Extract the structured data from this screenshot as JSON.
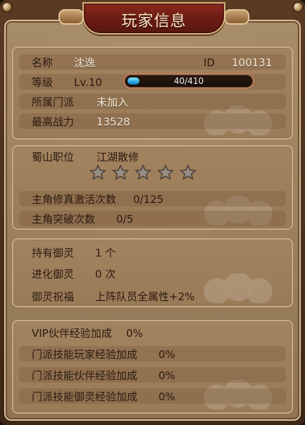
{
  "title": "玩家信息",
  "basic": {
    "name_label": "名称",
    "name_value": "沈逸",
    "id_label": "ID",
    "id_value": "100131",
    "level_label": "等级",
    "level_value": "Lv.10",
    "xp_current": 40,
    "xp_max": 410,
    "xp_text": "40/410",
    "sect_label": "所属门派",
    "sect_value": "未加入",
    "power_label": "最高战力",
    "power_value": "13528"
  },
  "shu": {
    "position_label": "蜀山职位",
    "position_value": "江湖散修",
    "stars_total": 5,
    "stars_filled": 0,
    "cultivate_label": "主角修真激活次数",
    "cultivate_value": "0/125",
    "breakthrough_label": "主角突破次数",
    "breakthrough_value": "0/5"
  },
  "yuling": {
    "own_label": "持有御灵",
    "own_value": "1 个",
    "evolve_label": "进化御灵",
    "evolve_value": "0 次",
    "bless_label": "御灵祝福",
    "bless_value": "上阵队员全属性+2%"
  },
  "bonuses": {
    "vip_label": "VIP伙伴经验加成",
    "vip_value": "0%",
    "player_label": "门派技能玩家经验加成",
    "player_value": "0%",
    "partner_label": "门派技能伙伴经验加成",
    "partner_value": "0%",
    "yuling_label": "门派技能御灵经验加成",
    "yuling_value": "0%"
  },
  "colors": {
    "panel": "#9b7f5d",
    "title_plate": "#6b1c14",
    "xp_fill": "#2aa8e4",
    "text_dark": "#2b1a10",
    "text_light": "#f4ead7"
  }
}
